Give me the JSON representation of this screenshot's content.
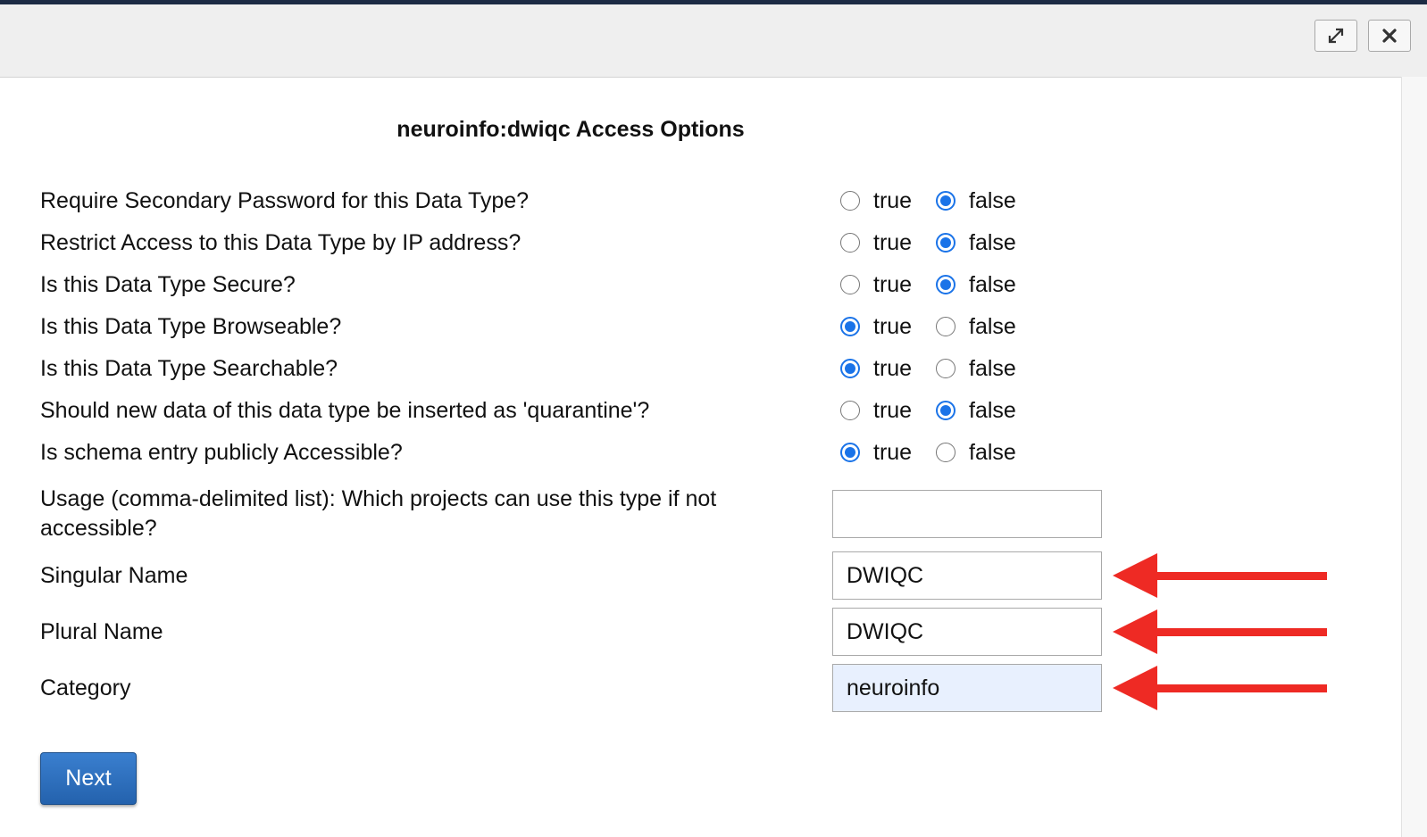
{
  "dialog": {
    "expand_icon": "expand-icon",
    "close_icon": "close-icon"
  },
  "form": {
    "title": "neuroinfo:dwiqc Access Options",
    "radio_options": {
      "true_label": "true",
      "false_label": "false"
    },
    "questions": [
      {
        "label": "Require Secondary Password for this Data Type?",
        "value": "false"
      },
      {
        "label": "Restrict Access to this Data Type by IP address?",
        "value": "false"
      },
      {
        "label": "Is this Data Type Secure?",
        "value": "false"
      },
      {
        "label": "Is this Data Type Browseable?",
        "value": "true"
      },
      {
        "label": "Is this Data Type Searchable?",
        "value": "true"
      },
      {
        "label": "Should new data of this data type be inserted as 'quarantine'?",
        "value": "false"
      },
      {
        "label": "Is schema entry publicly Accessible?",
        "value": "true"
      }
    ],
    "usage": {
      "label": "Usage (comma-delimited list): Which projects can use this type if not accessible?",
      "value": ""
    },
    "singular_name": {
      "label": "Singular Name",
      "value": "DWIQC"
    },
    "plural_name": {
      "label": "Plural Name",
      "value": "DWIQC"
    },
    "category": {
      "label": "Category",
      "value": "neuroinfo"
    },
    "next_label": "Next"
  },
  "annotation": {
    "arrow_color": "#ee2a24",
    "accent_color": "#1a73e8"
  }
}
